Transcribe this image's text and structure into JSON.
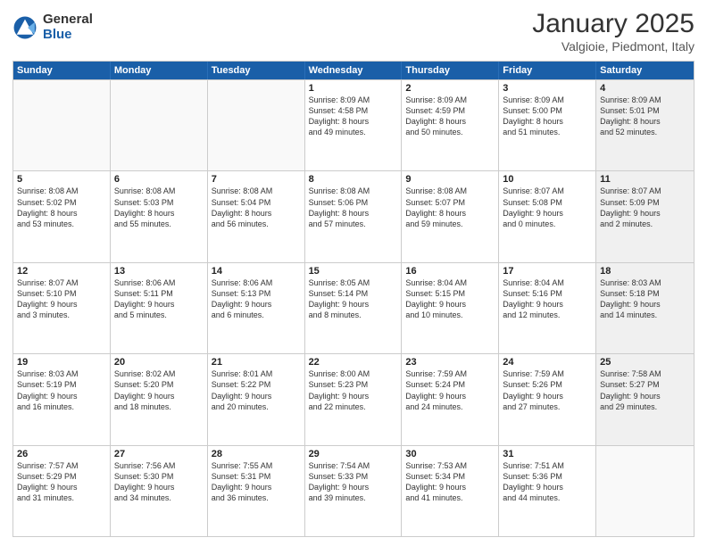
{
  "header": {
    "logo_general": "General",
    "logo_blue": "Blue",
    "title": "January 2025",
    "location": "Valgioie, Piedmont, Italy"
  },
  "days_of_week": [
    "Sunday",
    "Monday",
    "Tuesday",
    "Wednesday",
    "Thursday",
    "Friday",
    "Saturday"
  ],
  "rows": [
    [
      {
        "day": "",
        "text": "",
        "shaded": false,
        "empty": true
      },
      {
        "day": "",
        "text": "",
        "shaded": false,
        "empty": true
      },
      {
        "day": "",
        "text": "",
        "shaded": false,
        "empty": true
      },
      {
        "day": "1",
        "text": "Sunrise: 8:09 AM\nSunset: 4:58 PM\nDaylight: 8 hours\nand 49 minutes.",
        "shaded": false,
        "empty": false
      },
      {
        "day": "2",
        "text": "Sunrise: 8:09 AM\nSunset: 4:59 PM\nDaylight: 8 hours\nand 50 minutes.",
        "shaded": false,
        "empty": false
      },
      {
        "day": "3",
        "text": "Sunrise: 8:09 AM\nSunset: 5:00 PM\nDaylight: 8 hours\nand 51 minutes.",
        "shaded": false,
        "empty": false
      },
      {
        "day": "4",
        "text": "Sunrise: 8:09 AM\nSunset: 5:01 PM\nDaylight: 8 hours\nand 52 minutes.",
        "shaded": true,
        "empty": false
      }
    ],
    [
      {
        "day": "5",
        "text": "Sunrise: 8:08 AM\nSunset: 5:02 PM\nDaylight: 8 hours\nand 53 minutes.",
        "shaded": false,
        "empty": false
      },
      {
        "day": "6",
        "text": "Sunrise: 8:08 AM\nSunset: 5:03 PM\nDaylight: 8 hours\nand 55 minutes.",
        "shaded": false,
        "empty": false
      },
      {
        "day": "7",
        "text": "Sunrise: 8:08 AM\nSunset: 5:04 PM\nDaylight: 8 hours\nand 56 minutes.",
        "shaded": false,
        "empty": false
      },
      {
        "day": "8",
        "text": "Sunrise: 8:08 AM\nSunset: 5:06 PM\nDaylight: 8 hours\nand 57 minutes.",
        "shaded": false,
        "empty": false
      },
      {
        "day": "9",
        "text": "Sunrise: 8:08 AM\nSunset: 5:07 PM\nDaylight: 8 hours\nand 59 minutes.",
        "shaded": false,
        "empty": false
      },
      {
        "day": "10",
        "text": "Sunrise: 8:07 AM\nSunset: 5:08 PM\nDaylight: 9 hours\nand 0 minutes.",
        "shaded": false,
        "empty": false
      },
      {
        "day": "11",
        "text": "Sunrise: 8:07 AM\nSunset: 5:09 PM\nDaylight: 9 hours\nand 2 minutes.",
        "shaded": true,
        "empty": false
      }
    ],
    [
      {
        "day": "12",
        "text": "Sunrise: 8:07 AM\nSunset: 5:10 PM\nDaylight: 9 hours\nand 3 minutes.",
        "shaded": false,
        "empty": false
      },
      {
        "day": "13",
        "text": "Sunrise: 8:06 AM\nSunset: 5:11 PM\nDaylight: 9 hours\nand 5 minutes.",
        "shaded": false,
        "empty": false
      },
      {
        "day": "14",
        "text": "Sunrise: 8:06 AM\nSunset: 5:13 PM\nDaylight: 9 hours\nand 6 minutes.",
        "shaded": false,
        "empty": false
      },
      {
        "day": "15",
        "text": "Sunrise: 8:05 AM\nSunset: 5:14 PM\nDaylight: 9 hours\nand 8 minutes.",
        "shaded": false,
        "empty": false
      },
      {
        "day": "16",
        "text": "Sunrise: 8:04 AM\nSunset: 5:15 PM\nDaylight: 9 hours\nand 10 minutes.",
        "shaded": false,
        "empty": false
      },
      {
        "day": "17",
        "text": "Sunrise: 8:04 AM\nSunset: 5:16 PM\nDaylight: 9 hours\nand 12 minutes.",
        "shaded": false,
        "empty": false
      },
      {
        "day": "18",
        "text": "Sunrise: 8:03 AM\nSunset: 5:18 PM\nDaylight: 9 hours\nand 14 minutes.",
        "shaded": true,
        "empty": false
      }
    ],
    [
      {
        "day": "19",
        "text": "Sunrise: 8:03 AM\nSunset: 5:19 PM\nDaylight: 9 hours\nand 16 minutes.",
        "shaded": false,
        "empty": false
      },
      {
        "day": "20",
        "text": "Sunrise: 8:02 AM\nSunset: 5:20 PM\nDaylight: 9 hours\nand 18 minutes.",
        "shaded": false,
        "empty": false
      },
      {
        "day": "21",
        "text": "Sunrise: 8:01 AM\nSunset: 5:22 PM\nDaylight: 9 hours\nand 20 minutes.",
        "shaded": false,
        "empty": false
      },
      {
        "day": "22",
        "text": "Sunrise: 8:00 AM\nSunset: 5:23 PM\nDaylight: 9 hours\nand 22 minutes.",
        "shaded": false,
        "empty": false
      },
      {
        "day": "23",
        "text": "Sunrise: 7:59 AM\nSunset: 5:24 PM\nDaylight: 9 hours\nand 24 minutes.",
        "shaded": false,
        "empty": false
      },
      {
        "day": "24",
        "text": "Sunrise: 7:59 AM\nSunset: 5:26 PM\nDaylight: 9 hours\nand 27 minutes.",
        "shaded": false,
        "empty": false
      },
      {
        "day": "25",
        "text": "Sunrise: 7:58 AM\nSunset: 5:27 PM\nDaylight: 9 hours\nand 29 minutes.",
        "shaded": true,
        "empty": false
      }
    ],
    [
      {
        "day": "26",
        "text": "Sunrise: 7:57 AM\nSunset: 5:29 PM\nDaylight: 9 hours\nand 31 minutes.",
        "shaded": false,
        "empty": false
      },
      {
        "day": "27",
        "text": "Sunrise: 7:56 AM\nSunset: 5:30 PM\nDaylight: 9 hours\nand 34 minutes.",
        "shaded": false,
        "empty": false
      },
      {
        "day": "28",
        "text": "Sunrise: 7:55 AM\nSunset: 5:31 PM\nDaylight: 9 hours\nand 36 minutes.",
        "shaded": false,
        "empty": false
      },
      {
        "day": "29",
        "text": "Sunrise: 7:54 AM\nSunset: 5:33 PM\nDaylight: 9 hours\nand 39 minutes.",
        "shaded": false,
        "empty": false
      },
      {
        "day": "30",
        "text": "Sunrise: 7:53 AM\nSunset: 5:34 PM\nDaylight: 9 hours\nand 41 minutes.",
        "shaded": false,
        "empty": false
      },
      {
        "day": "31",
        "text": "Sunrise: 7:51 AM\nSunset: 5:36 PM\nDaylight: 9 hours\nand 44 minutes.",
        "shaded": false,
        "empty": false
      },
      {
        "day": "",
        "text": "",
        "shaded": true,
        "empty": true
      }
    ]
  ]
}
